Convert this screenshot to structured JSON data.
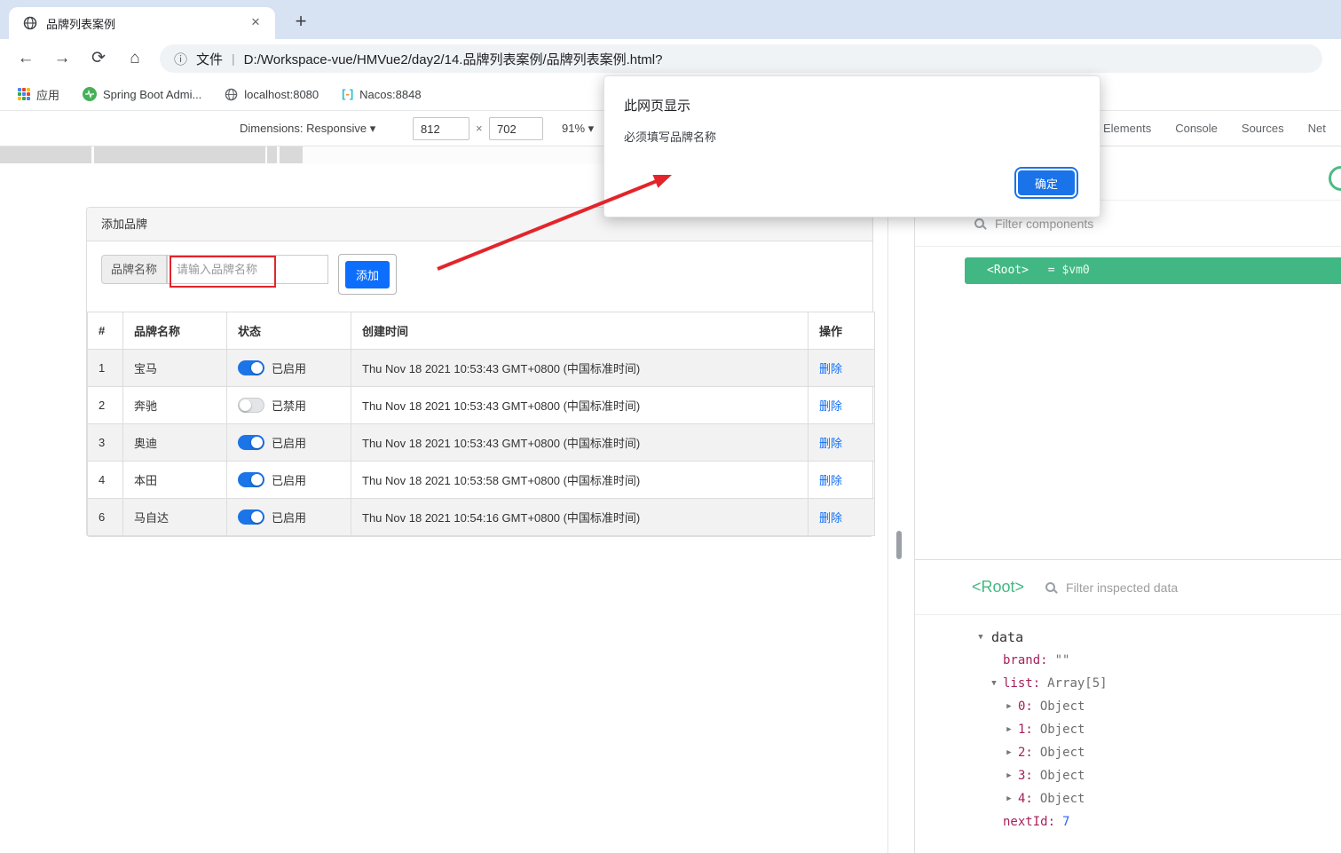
{
  "colors": {
    "vue_green": "#41b883",
    "dialog_button_blue": "#1a73e8",
    "primary_blue": "#0d6efd",
    "toggle_on_blue": "#1b74e8",
    "annotation_red": "#e3242b",
    "tree_key_color": "#a6215c",
    "tree_number_color": "#2962ff"
  },
  "icons": {
    "back": "←",
    "forward": "→",
    "reload": "⟳",
    "home": "⌂",
    "info": "ⓘ",
    "close": "×",
    "new_tab": "+",
    "dropdown": "▾",
    "separator": "|",
    "times": "×"
  },
  "browser": {
    "tab_title": "品牌列表案例",
    "url_scheme": "文件",
    "url": "D:/Workspace-vue/HMVue2/day2/14.品牌列表案例/品牌列表案例.html?",
    "bookmarks": [
      {
        "label": "应用"
      },
      {
        "label": "Spring Boot Admi..."
      },
      {
        "label": "localhost:8080"
      },
      {
        "label": "Nacos:8848"
      }
    ]
  },
  "device_toolbar": {
    "dimensions_label": "Dimensions: Responsive",
    "width": "812",
    "height": "702",
    "zoom": "91%"
  },
  "dialog": {
    "title": "此网页显示",
    "message": "必须填写品牌名称",
    "ok_label": "确定"
  },
  "page": {
    "panel_title": "添加品牌",
    "form": {
      "name_label": "品牌名称",
      "name_placeholder": "请输入品牌名称",
      "add_label": "添加"
    },
    "table": {
      "headers": [
        "#",
        "品牌名称",
        "状态",
        "创建时间",
        "操作"
      ],
      "rows": [
        {
          "id": "1",
          "name": "宝马",
          "enabled": true,
          "status": "已启用",
          "created": "Thu Nov 18 2021 10:53:43 GMT+0800 (中国标准时间)",
          "action": "删除"
        },
        {
          "id": "2",
          "name": "奔驰",
          "enabled": false,
          "status": "已禁用",
          "created": "Thu Nov 18 2021 10:53:43 GMT+0800 (中国标准时间)",
          "action": "删除"
        },
        {
          "id": "3",
          "name": "奥迪",
          "enabled": true,
          "status": "已启用",
          "created": "Thu Nov 18 2021 10:53:43 GMT+0800 (中国标准时间)",
          "action": "删除"
        },
        {
          "id": "4",
          "name": "本田",
          "enabled": true,
          "status": "已启用",
          "created": "Thu Nov 18 2021 10:53:58 GMT+0800 (中国标准时间)",
          "action": "删除"
        },
        {
          "id": "6",
          "name": "马自达",
          "enabled": true,
          "status": "已启用",
          "created": "Thu Nov 18 2021 10:54:16 GMT+0800 (中国标准时间)",
          "action": "删除"
        }
      ]
    }
  },
  "devtools": {
    "tabs": [
      {
        "label": "Elements"
      },
      {
        "label": "Console"
      },
      {
        "label": "Sources"
      },
      {
        "label": "Net"
      }
    ],
    "components_filter_placeholder": "Filter components",
    "selected_component": "<Root>",
    "selected_binding": "= $vm0",
    "inspector": {
      "component_label": "<Root>",
      "filter_placeholder": "Filter inspected data",
      "rows": [
        {
          "arrow": "▼",
          "key": "data",
          "value": ""
        },
        {
          "arrow": "",
          "key": "brand:",
          "value": "\"\""
        },
        {
          "arrow": "▼",
          "key": "list:",
          "value": "Array[5]"
        },
        {
          "arrow": "▶",
          "key": "0:",
          "value": "Object"
        },
        {
          "arrow": "▶",
          "key": "1:",
          "value": "Object"
        },
        {
          "arrow": "▶",
          "key": "2:",
          "value": "Object"
        },
        {
          "arrow": "▶",
          "key": "3:",
          "value": "Object"
        },
        {
          "arrow": "▶",
          "key": "4:",
          "value": "Object"
        },
        {
          "arrow": "",
          "key": "nextId:",
          "value": "7"
        }
      ]
    }
  }
}
